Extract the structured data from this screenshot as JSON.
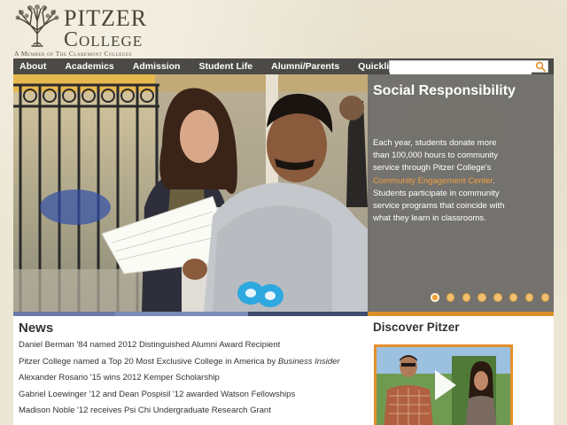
{
  "header": {
    "logo_name_line1": "Pitzer",
    "logo_name_line2": "College",
    "logo_tagline": "A Member of The Claremont Colleges"
  },
  "nav": {
    "items": [
      "About",
      "Academics",
      "Admission",
      "Student Life",
      "Alumni/Parents",
      "Quicklinks"
    ],
    "search_value": "",
    "search_placeholder": ""
  },
  "hero": {
    "title": "Social Responsibility",
    "body_before": "Each year, students donate more than 100,000 hours to community service through Pitzer College's ",
    "link": "Community Engagement Center",
    "body_after": ". Students participate in community service programs that coincide with what they learn in classrooms.",
    "slide_count": 8,
    "active_slide": 1
  },
  "band_colors": [
    "#6b7aa6",
    "#7b8bb8",
    "#3e4a6e",
    "#d9902a"
  ],
  "news": {
    "title": "News",
    "items": [
      {
        "text": "Daniel Berman '84 named 2012 Distinguished Alumni Award Recipient",
        "emph": ""
      },
      {
        "text": "Pitzer College named a Top 20 Most Exclusive College in America by ",
        "emph": "Business Insider"
      },
      {
        "text": "Alexander Rosario '15 wins 2012 Kemper Scholarship",
        "emph": ""
      },
      {
        "text": "Gabriel Loewinger '12 and Dean Pospisil '12 awarded Watson Fellowships",
        "emph": ""
      },
      {
        "text": "Madison Noble '12 receives Psi Chi Undergraduate Research Grant",
        "emph": ""
      }
    ]
  },
  "discover": {
    "title": "Discover Pitzer"
  },
  "colors": {
    "nav_bg": "#4b4a46",
    "accent_orange": "#e5902c",
    "panel_gray": "#6e6c68"
  }
}
